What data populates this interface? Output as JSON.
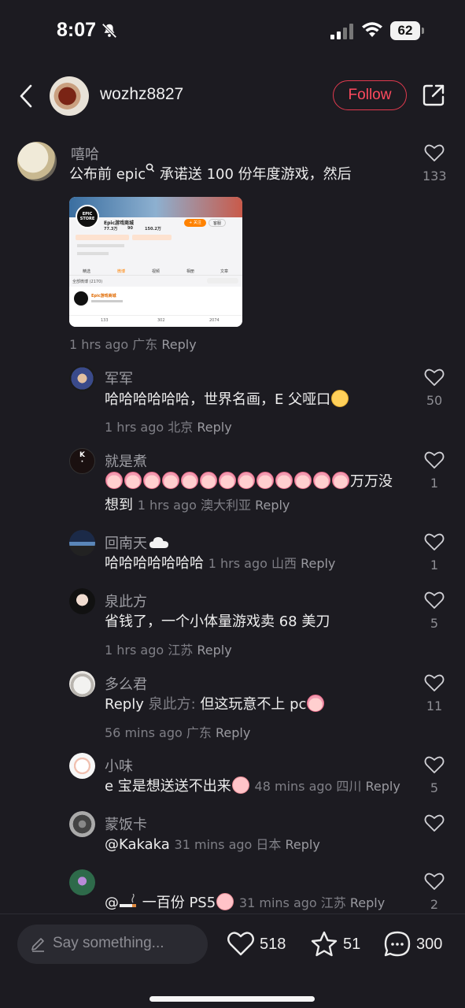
{
  "status": {
    "time": "8:07",
    "battery": "62"
  },
  "header": {
    "username": "wozhz8827",
    "follow_label": "Follow"
  },
  "comments": [
    {
      "name": "嘻哈",
      "text": "公布前 epic",
      "text_after": " 承诺送 100 份年度游戏，然后",
      "meta": "1 hrs ago 广东",
      "reply": "Reply",
      "likes": "133"
    },
    {
      "name": "军军",
      "text": "哈哈哈哈哈哈，世界名画，E 父哑口",
      "meta": "1 hrs ago 北京",
      "reply": "Reply",
      "likes": "50"
    },
    {
      "name": "就是煮",
      "text": "万万没",
      "text2": "想到",
      "meta": "1 hrs ago 澳大利亚",
      "reply": "Reply",
      "likes": "1"
    },
    {
      "name": "回南天",
      "text": "哈哈哈哈哈哈哈",
      "meta": "1 hrs ago 山西",
      "reply": "Reply",
      "likes": "1"
    },
    {
      "name": "泉此方",
      "text": "省钱了，一个小体量游戏卖 68 美刀",
      "meta": "1 hrs ago 江苏",
      "reply": "Reply",
      "likes": "5"
    },
    {
      "name": "多么君",
      "reply_prefix": "Reply",
      "reply_to": "泉此方:",
      "text": " 但这玩意不上 pc",
      "meta": "56 mins ago 广东",
      "reply": "Reply",
      "likes": "11"
    },
    {
      "name": "小味",
      "text": "e 宝是想送送不出来",
      "meta": "48 mins ago 四川",
      "reply": "Reply",
      "likes": "5"
    },
    {
      "name": "蒙饭卡",
      "text": "@Kakaka",
      "meta": "31 mins ago 日本",
      "reply": "Reply",
      "likes": ""
    },
    {
      "name": "",
      "text": "@",
      "text_after": " 一百份 PS5",
      "meta": "31 mins ago 江苏",
      "reply": "Reply",
      "likes": "2"
    }
  ],
  "thumbnail": {
    "store_name": "Epic游戏商城",
    "logo_text1": "EPIC",
    "logo_text2": "STORE",
    "followers": "77.3万",
    "following": "90",
    "likes_total": "150.2万",
    "follow_btn": "+ 关注",
    "msg_btn": "客服",
    "tabs": [
      "精选",
      "微博",
      "视频",
      "相册",
      "文章"
    ],
    "filter": "全部微博 (2170)",
    "post_name": "Epic游戏商城",
    "post_counts": [
      "133",
      "302",
      "2074"
    ]
  },
  "bottom": {
    "placeholder": "Say something...",
    "likes": "518",
    "stars": "51",
    "comments": "300"
  },
  "colors": {
    "background": "#1c1b21",
    "accent": "#ff4a5e",
    "muted": "#8d8d93"
  }
}
